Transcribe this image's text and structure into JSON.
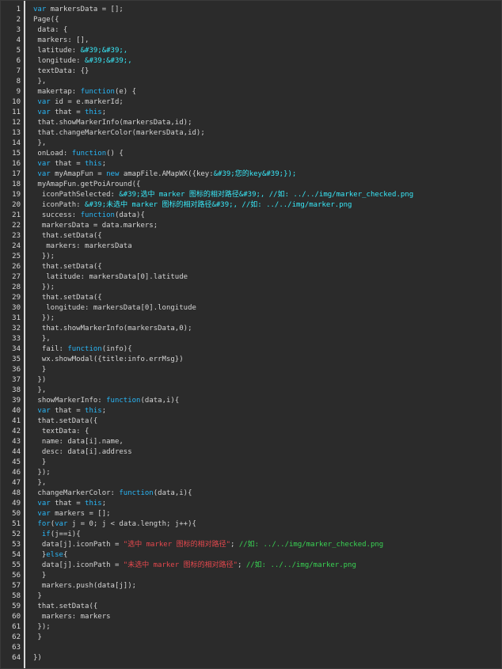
{
  "editor": {
    "lines": [
      [
        [
          "kw",
          "var"
        ],
        [
          "pl",
          " markersData = [];"
        ]
      ],
      [
        [
          "pl",
          "Page({"
        ]
      ],
      [
        [
          "pl",
          " data: {"
        ]
      ],
      [
        [
          "pl",
          " markers: [],"
        ]
      ],
      [
        [
          "pl",
          " latitude: "
        ],
        [
          "hl",
          "&#39;&#39;,"
        ]
      ],
      [
        [
          "pl",
          " longitude: "
        ],
        [
          "hl",
          "&#39;&#39;,"
        ]
      ],
      [
        [
          "pl",
          " textData: {}"
        ]
      ],
      [
        [
          "pl",
          " },"
        ]
      ],
      [
        [
          "pl",
          " makertap: "
        ],
        [
          "kw",
          "function"
        ],
        [
          "pl",
          "(e) {"
        ]
      ],
      [
        [
          "pl",
          " "
        ],
        [
          "kw",
          "var"
        ],
        [
          "pl",
          " id = e.markerId;"
        ]
      ],
      [
        [
          "pl",
          " "
        ],
        [
          "kw",
          "var"
        ],
        [
          "pl",
          " that = "
        ],
        [
          "kw",
          "this"
        ],
        [
          "pl",
          ";"
        ]
      ],
      [
        [
          "pl",
          " that.showMarkerInfo(markersData,id);"
        ]
      ],
      [
        [
          "pl",
          " that.changeMarkerColor(markersData,id);"
        ]
      ],
      [
        [
          "pl",
          " },"
        ]
      ],
      [
        [
          "pl",
          " onLoad: "
        ],
        [
          "kw",
          "function"
        ],
        [
          "pl",
          "() {"
        ]
      ],
      [
        [
          "pl",
          " "
        ],
        [
          "kw",
          "var"
        ],
        [
          "pl",
          " that = "
        ],
        [
          "kw",
          "this"
        ],
        [
          "pl",
          ";"
        ]
      ],
      [
        [
          "pl",
          " "
        ],
        [
          "kw",
          "var"
        ],
        [
          "pl",
          " myAmapFun = "
        ],
        [
          "kw",
          "new"
        ],
        [
          "pl",
          " amapFile.AMapWX({key:"
        ],
        [
          "hl",
          "&#39;您的key&#39;});"
        ]
      ],
      [
        [
          "pl",
          " myAmapFun.getPoiAround({"
        ]
      ],
      [
        [
          "pl",
          "  iconPathSelected: "
        ],
        [
          "hl",
          "&#39;选中 marker 图标的相对路径&#39;, //如: ../../img/marker_checked.png"
        ]
      ],
      [
        [
          "pl",
          "  iconPath: "
        ],
        [
          "hl",
          "&#39;未选中 marker 图标的相对路径&#39;, //如: ../../img/marker.png"
        ]
      ],
      [
        [
          "pl",
          "  success: "
        ],
        [
          "kw",
          "function"
        ],
        [
          "pl",
          "(data){"
        ]
      ],
      [
        [
          "pl",
          "  markersData = data.markers;"
        ]
      ],
      [
        [
          "pl",
          "  that.setData({"
        ]
      ],
      [
        [
          "pl",
          "   markers: markersData"
        ]
      ],
      [
        [
          "pl",
          "  });"
        ]
      ],
      [
        [
          "pl",
          "  that.setData({"
        ]
      ],
      [
        [
          "pl",
          "   latitude: markersData[0].latitude"
        ]
      ],
      [
        [
          "pl",
          "  });"
        ]
      ],
      [
        [
          "pl",
          "  that.setData({"
        ]
      ],
      [
        [
          "pl",
          "   longitude: markersData[0].longitude"
        ]
      ],
      [
        [
          "pl",
          "  });"
        ]
      ],
      [
        [
          "pl",
          "  that.showMarkerInfo(markersData,0);"
        ]
      ],
      [
        [
          "pl",
          "  },"
        ]
      ],
      [
        [
          "pl",
          "  fail: "
        ],
        [
          "kw",
          "function"
        ],
        [
          "pl",
          "(info){"
        ]
      ],
      [
        [
          "pl",
          "  wx.showModal({title:info.errMsg})"
        ]
      ],
      [
        [
          "pl",
          "  }"
        ]
      ],
      [
        [
          "pl",
          " })"
        ]
      ],
      [
        [
          "pl",
          " },"
        ]
      ],
      [
        [
          "pl",
          " showMarkerInfo: "
        ],
        [
          "kw",
          "function"
        ],
        [
          "pl",
          "(data,i){"
        ]
      ],
      [
        [
          "pl",
          " "
        ],
        [
          "kw",
          "var"
        ],
        [
          "pl",
          " that = "
        ],
        [
          "kw",
          "this"
        ],
        [
          "pl",
          ";"
        ]
      ],
      [
        [
          "pl",
          " that.setData({"
        ]
      ],
      [
        [
          "pl",
          "  textData: {"
        ]
      ],
      [
        [
          "pl",
          "  name: data[i].name,"
        ]
      ],
      [
        [
          "pl",
          "  desc: data[i].address"
        ]
      ],
      [
        [
          "pl",
          "  }"
        ]
      ],
      [
        [
          "pl",
          " });"
        ]
      ],
      [
        [
          "pl",
          " },"
        ]
      ],
      [
        [
          "pl",
          " changeMarkerColor: "
        ],
        [
          "kw",
          "function"
        ],
        [
          "pl",
          "(data,i){"
        ]
      ],
      [
        [
          "pl",
          " "
        ],
        [
          "kw",
          "var"
        ],
        [
          "pl",
          " that = "
        ],
        [
          "kw",
          "this"
        ],
        [
          "pl",
          ";"
        ]
      ],
      [
        [
          "pl",
          " "
        ],
        [
          "kw",
          "var"
        ],
        [
          "pl",
          " markers = [];"
        ]
      ],
      [
        [
          "pl",
          " "
        ],
        [
          "kw",
          "for"
        ],
        [
          "pl",
          "("
        ],
        [
          "kw",
          "var"
        ],
        [
          "pl",
          " j = 0; j < data.length; j++){"
        ]
      ],
      [
        [
          "pl",
          "  "
        ],
        [
          "kw",
          "if"
        ],
        [
          "pl",
          "(j==i){"
        ]
      ],
      [
        [
          "pl",
          "  data[j].iconPath = "
        ],
        [
          "st",
          "\"选中 marker 图标的相对路径\""
        ],
        [
          "pl",
          "; "
        ],
        [
          "cm",
          "//如: ../../img/marker_checked.png"
        ]
      ],
      [
        [
          "pl",
          "  }"
        ],
        [
          "kw",
          "else"
        ],
        [
          "pl",
          "{"
        ]
      ],
      [
        [
          "pl",
          "  data[j].iconPath = "
        ],
        [
          "st",
          "\"未选中 marker 图标的相对路径\""
        ],
        [
          "pl",
          "; "
        ],
        [
          "cm",
          "//如: ../../img/marker.png"
        ]
      ],
      [
        [
          "pl",
          "  }"
        ]
      ],
      [
        [
          "pl",
          "  markers.push(data[j]);"
        ]
      ],
      [
        [
          "pl",
          " }"
        ]
      ],
      [
        [
          "pl",
          " that.setData({"
        ]
      ],
      [
        [
          "pl",
          "  markers: markers"
        ]
      ],
      [
        [
          "pl",
          " });"
        ]
      ],
      [
        [
          "pl",
          " }"
        ]
      ],
      [
        [
          "pl",
          ""
        ]
      ],
      [
        [
          "pl",
          "})"
        ]
      ]
    ]
  }
}
